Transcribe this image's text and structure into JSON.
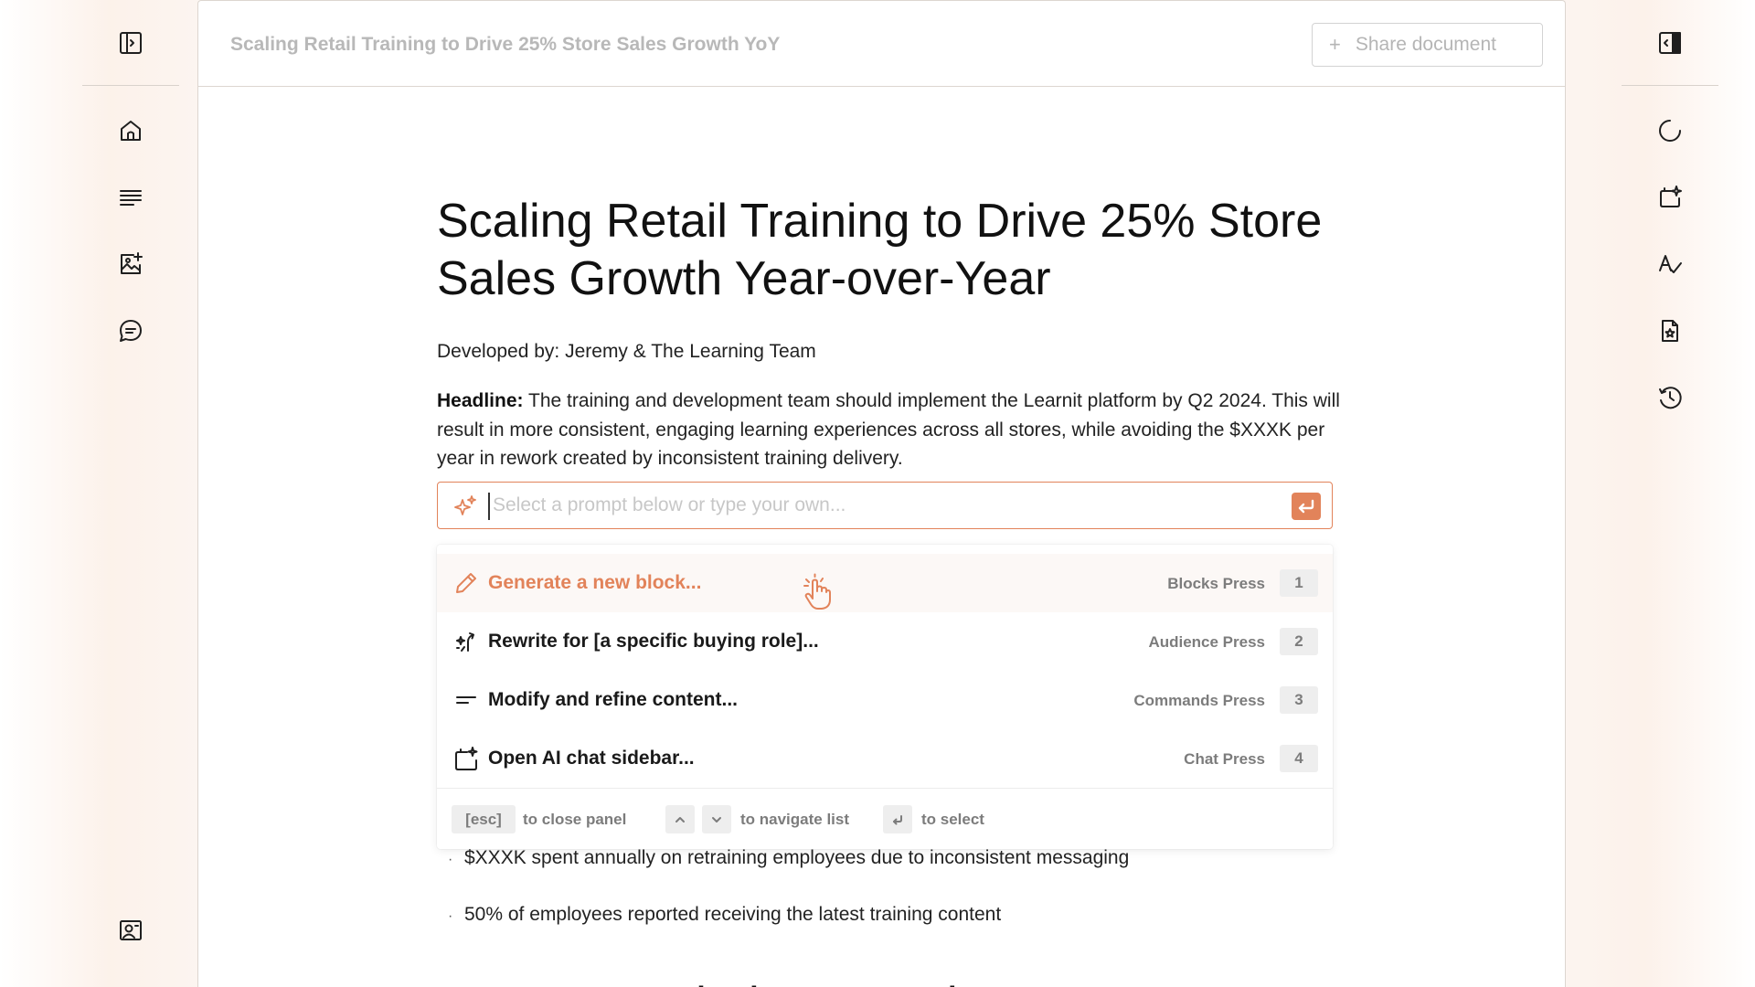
{
  "header": {
    "title": "Scaling Retail Training to Drive 25% Store Sales Growth YoY",
    "share_icon": "+",
    "share_label": "Share document"
  },
  "document": {
    "title": "Scaling Retail Training to Drive 25% Store Sales Growth Year-over-Year",
    "developed_by": "Developed by: Jeremy & The Learning Team",
    "headline_label": "Headline:",
    "headline_text": " The training and development team should implement the Learnit platform by Q2 2024. This will result in more consistent, engaging learning experiences across all stores, while avoiding the $XXXK per year in rework created by inconsistent training delivery.",
    "bullets": [
      "$XXXK spent annually on retraining employees due to inconsistent messaging",
      "50% of employees reported receiving the latest training content"
    ],
    "bullet_glyph": "·",
    "next_heading": "Recommended Approach"
  },
  "prompt": {
    "placeholder": "Select a prompt below or type your own...",
    "value": ""
  },
  "menu": {
    "items": [
      {
        "label": "Generate a new block...",
        "hint": "Blocks Press",
        "key": "1",
        "icon": "pencil-icon"
      },
      {
        "label": "Rewrite for [a specific buying role]...",
        "hint": "Audience Press",
        "key": "2",
        "icon": "audience-wand-icon"
      },
      {
        "label": "Modify and refine content...",
        "hint": "Commands Press",
        "key": "3",
        "icon": "lines-icon"
      },
      {
        "label": "Open AI chat sidebar...",
        "hint": "Chat Press",
        "key": "4",
        "icon": "ai-chat-icon"
      }
    ],
    "footer": {
      "esc_key": "[esc]",
      "close_text": "to close panel",
      "navigate_text": "to navigate list",
      "select_text": "to select"
    }
  },
  "left_rail": [
    "toggle-sidebar-icon",
    "home-icon",
    "outline-icon",
    "add-image-icon",
    "comment-icon",
    "presenter-icon"
  ],
  "right_rail": [
    "toggle-panel-icon",
    "loading-icon",
    "ai-sidebar-icon",
    "spellcheck-icon",
    "favorite-doc-icon",
    "history-icon"
  ],
  "colors": {
    "accent": "#e2835a",
    "muted_text": "#7c7c7c",
    "border": "#ddd6d0"
  }
}
